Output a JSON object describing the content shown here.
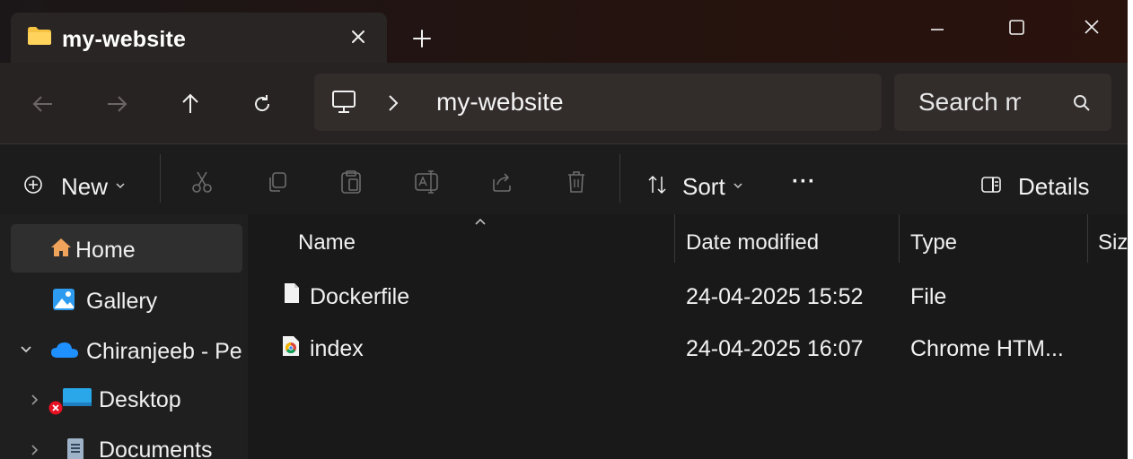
{
  "tab": {
    "title": "my-website"
  },
  "address": {
    "segment": "my-website"
  },
  "search": {
    "placeholder": "Search my"
  },
  "toolbar": {
    "new_label": "New",
    "sort_label": "Sort",
    "more_label": "···",
    "details_label": "Details"
  },
  "sidebar": {
    "items": [
      {
        "label": "Home",
        "icon": "home-icon",
        "selected": true
      },
      {
        "label": "Gallery",
        "icon": "gallery-icon"
      },
      {
        "label": "Chiranjeeb - Pe",
        "icon": "onedrive-cloud-icon",
        "expanded": true
      },
      {
        "label": "Desktop",
        "icon": "desktop-icon",
        "status": "sync-error"
      },
      {
        "label": "Documents",
        "icon": "documents-icon"
      }
    ]
  },
  "columns": {
    "name": "Name",
    "date": "Date modified",
    "type": "Type",
    "size": "Siz"
  },
  "files": [
    {
      "name": "Dockerfile",
      "date": "24-04-2025 15:52",
      "type": "File",
      "icon": "file-icon"
    },
    {
      "name": "index",
      "date": "24-04-2025 16:07",
      "type": "Chrome HTM...",
      "icon": "chrome-html-icon"
    }
  ],
  "colors": {
    "accent_folder": "#f5c242",
    "onedrive": "#1e90ff",
    "error": "#e81123"
  }
}
